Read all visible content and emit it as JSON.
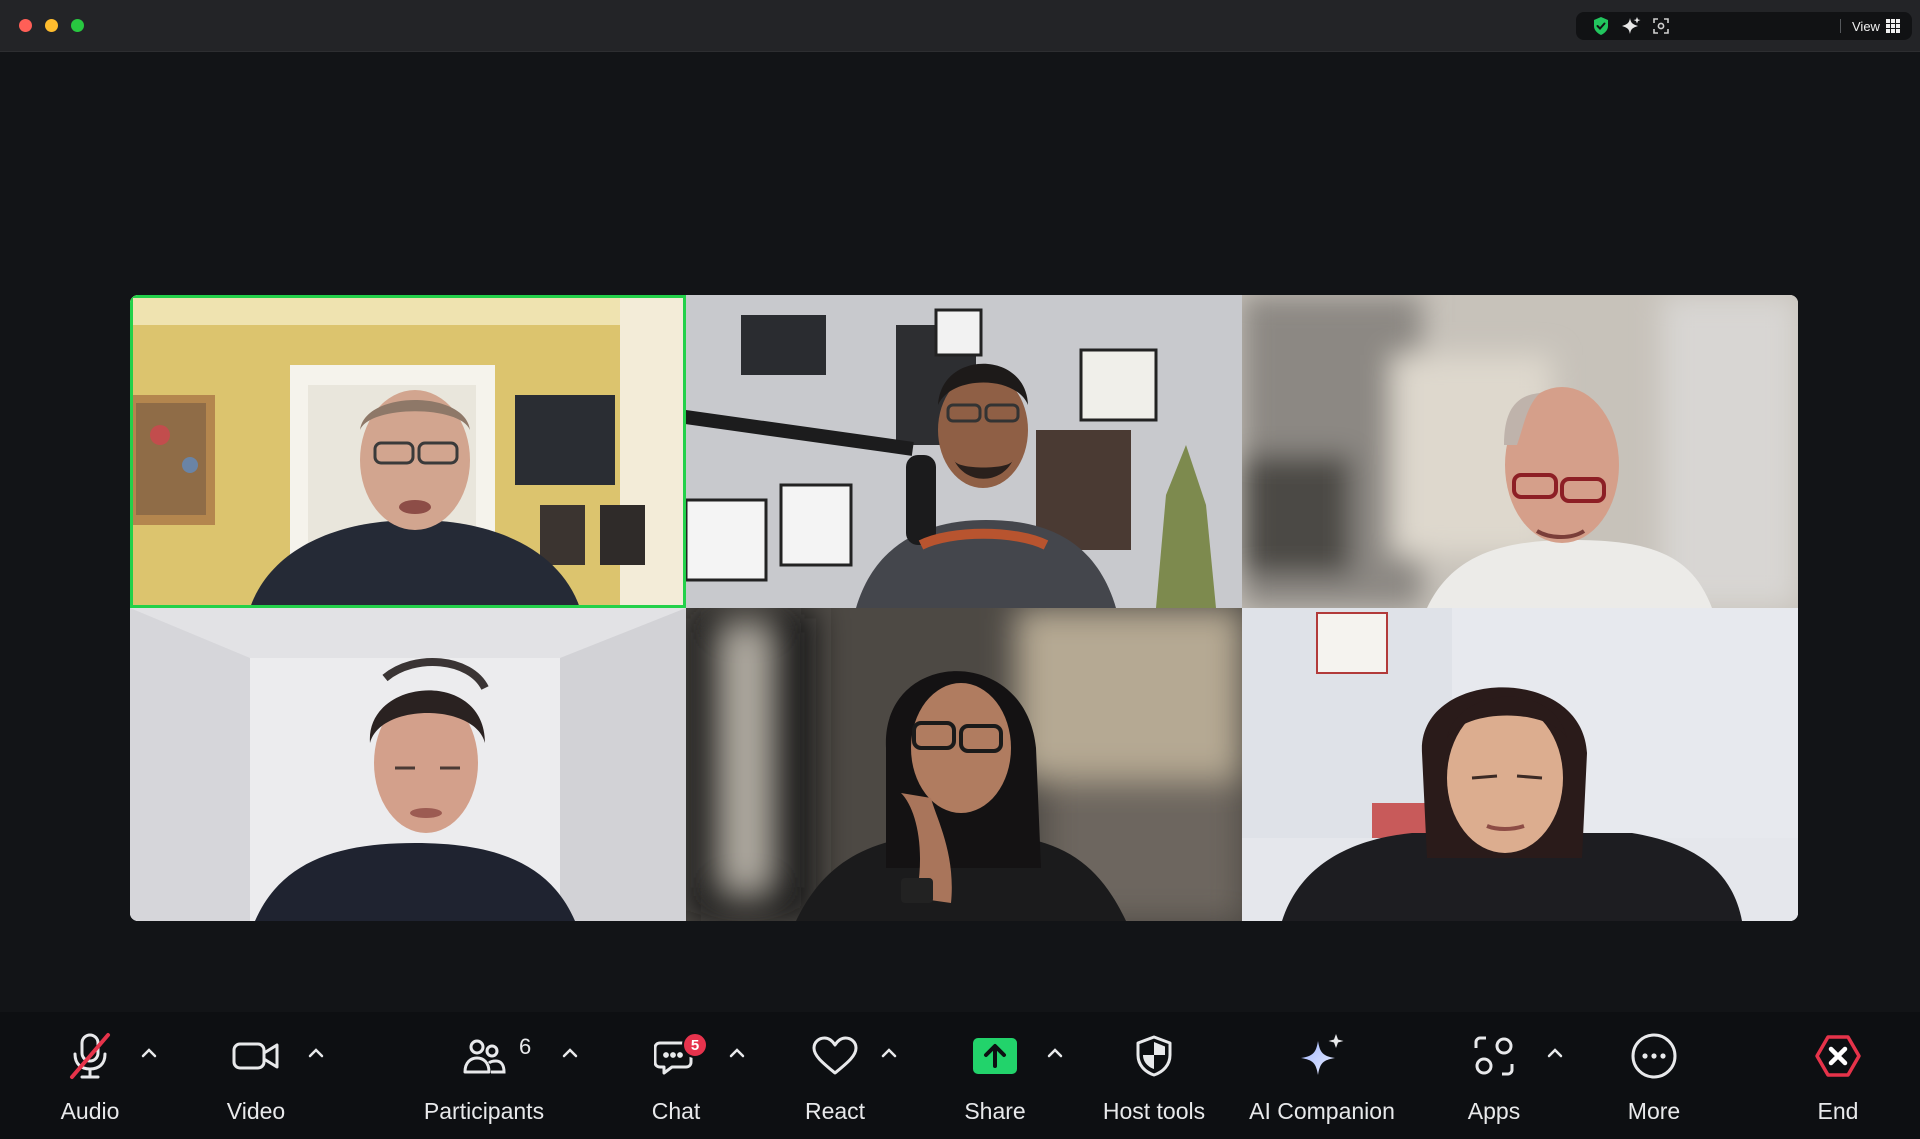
{
  "window": {
    "view_label": "View"
  },
  "participants_grid": [
    {
      "id": "p1",
      "active_speaker": true
    },
    {
      "id": "p2",
      "active_speaker": false
    },
    {
      "id": "p3",
      "active_speaker": false
    },
    {
      "id": "p4",
      "active_speaker": false
    },
    {
      "id": "p5",
      "active_speaker": false
    },
    {
      "id": "p6",
      "active_speaker": false
    }
  ],
  "toolbar": {
    "audio_label": "Audio",
    "video_label": "Video",
    "participants_label": "Participants",
    "participants_count": "6",
    "chat_label": "Chat",
    "chat_badge": "5",
    "react_label": "React",
    "share_label": "Share",
    "host_tools_label": "Host tools",
    "ai_companion_label": "AI Companion",
    "apps_label": "Apps",
    "more_label": "More",
    "end_label": "End"
  },
  "colors": {
    "active_speaker_border": "#23d14a",
    "share_button": "#22d36b",
    "end_button": "#e6334a",
    "chat_badge": "#e7334d",
    "muted_slash": "#e6334a"
  },
  "icons": {
    "audio": "microphone-muted-icon",
    "video": "video-camera-icon",
    "participants": "people-icon",
    "chat": "chat-bubble-icon",
    "react": "heart-icon",
    "share": "share-arrow-icon",
    "host_tools": "shield-icon",
    "ai_companion": "sparkle-icon",
    "apps": "apps-icon",
    "more": "more-dots-icon",
    "end": "end-call-icon"
  }
}
